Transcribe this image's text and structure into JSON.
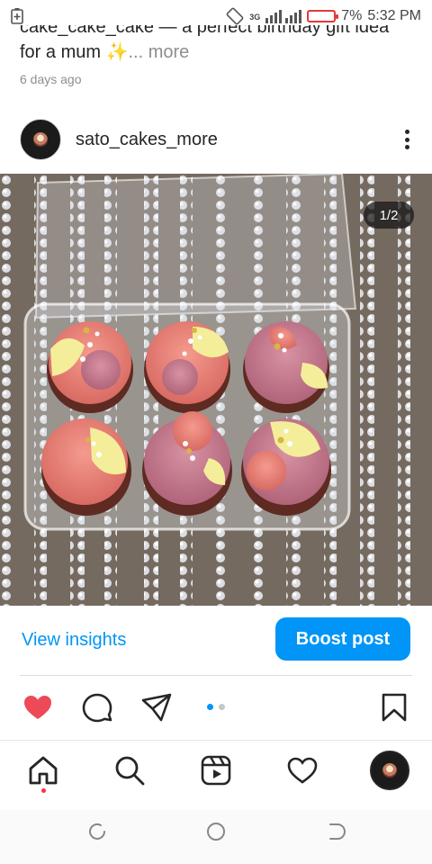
{
  "status_bar": {
    "network": "3G",
    "battery": "7%",
    "time": "5:32 PM"
  },
  "caption": {
    "cut_line": "cake_cake_cake — a perfect birthday gift idea",
    "line": "for a mum ✨",
    "more": "... more",
    "timestamp": "6 days ago"
  },
  "post": {
    "username": "sato_cakes_more",
    "counter": "1/2"
  },
  "insights": {
    "view_label": "View insights",
    "boost_label": "Boost post"
  },
  "carousel": {
    "total": 2,
    "current": 1
  },
  "icons": {
    "like": "heart-filled-icon",
    "comment": "comment-icon",
    "share": "send-icon",
    "save": "bookmark-icon",
    "home": "home-icon",
    "search": "search-icon",
    "reels": "reels-icon",
    "activity": "heart-outline-icon"
  },
  "colors": {
    "accent": "#0095f6",
    "like": "#ed4956",
    "notification": "#ff3040"
  }
}
